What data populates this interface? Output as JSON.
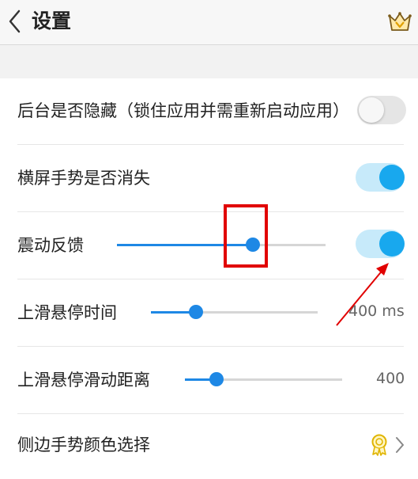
{
  "header": {
    "title": "设置",
    "back_icon": "chevron-left-icon",
    "vip_icon": "crown-icon"
  },
  "settings": [
    {
      "label": "后台是否隐藏（锁住应用并需重新启动应用）",
      "control": "toggle",
      "checked": false
    },
    {
      "label": "横屏手势是否消失",
      "control": "toggle",
      "checked": true
    },
    {
      "label": "震动反馈",
      "control": "slider+toggle",
      "slider_value_fraction": 0.65,
      "checked": true
    },
    {
      "label": "上滑悬停时间",
      "control": "slider",
      "slider_value_fraction": 0.27,
      "value": "400 ms"
    },
    {
      "label": "上滑悬停滑动距离",
      "control": "slider",
      "slider_value_fraction": 0.2,
      "value": "400"
    },
    {
      "label": "侧边手势颜色选择",
      "control": "link",
      "icon": "medal-icon"
    }
  ],
  "annotations": {
    "highlight": "red-box",
    "arrow": "red-arrow"
  },
  "colors": {
    "accent": "#18a8ee",
    "slider": "#1e88e5",
    "annotation": "#e10000"
  }
}
